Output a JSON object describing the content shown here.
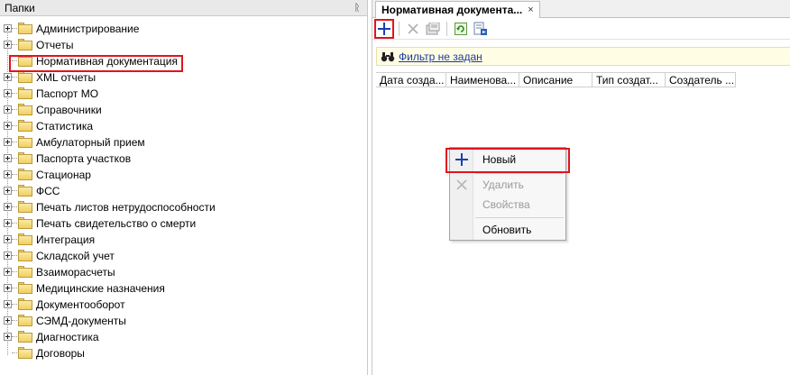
{
  "left_panel": {
    "title": "Папки",
    "pin_glyph": "ᚱ",
    "folders": [
      {
        "label": "Администрирование",
        "expandable": true
      },
      {
        "label": "Отчеты",
        "expandable": true
      },
      {
        "label": "Нормативная документация",
        "expandable": false,
        "selected": true
      },
      {
        "label": "XML отчеты",
        "expandable": true
      },
      {
        "label": "Паспорт МО",
        "expandable": true
      },
      {
        "label": "Справочники",
        "expandable": true
      },
      {
        "label": "Статистика",
        "expandable": true
      },
      {
        "label": "Амбулаторный прием",
        "expandable": true
      },
      {
        "label": "Паспорта участков",
        "expandable": true
      },
      {
        "label": "Стационар",
        "expandable": true
      },
      {
        "label": "ФСС",
        "expandable": true
      },
      {
        "label": "Печать листов нетрудоспособности",
        "expandable": true
      },
      {
        "label": "Печать свидетельство о смерти",
        "expandable": true
      },
      {
        "label": "Интеграция",
        "expandable": true
      },
      {
        "label": "Складской учет",
        "expandable": true
      },
      {
        "label": "Взаиморасчеты",
        "expandable": true
      },
      {
        "label": "Медицинские назначения",
        "expandable": true
      },
      {
        "label": "Документооборот",
        "expandable": true
      },
      {
        "label": "СЭМД-документы",
        "expandable": true
      },
      {
        "label": "Диагностика",
        "expandable": true
      },
      {
        "label": "Договоры",
        "expandable": false
      }
    ]
  },
  "right_panel": {
    "tab": {
      "label": "Нормативная документа...",
      "close_glyph": "×"
    },
    "toolbar": {
      "buttons": [
        {
          "name": "add-button",
          "icon": "plus-icon",
          "enabled": true
        },
        {
          "name": "delete-button",
          "icon": "x-icon",
          "enabled": false
        },
        {
          "name": "properties-button",
          "icon": "properties-icon",
          "enabled": false
        },
        {
          "name": "refresh-button",
          "icon": "refresh-icon",
          "enabled": true
        },
        {
          "name": "export-button",
          "icon": "export-icon",
          "enabled": true
        }
      ]
    },
    "filter": {
      "label": "Фильтр не задан"
    },
    "columns": [
      {
        "label": "Дата созда..."
      },
      {
        "label": "Наименова..."
      },
      {
        "label": "Описание"
      },
      {
        "label": "Тип создат..."
      },
      {
        "label": "Создатель ..."
      }
    ]
  },
  "context_menu": {
    "items": [
      {
        "label": "Новый",
        "icon": "plus-icon",
        "enabled": true
      },
      {
        "label": "Удалить",
        "icon": "x-icon",
        "enabled": false
      },
      {
        "label": "Свойства",
        "icon": "",
        "enabled": false
      },
      {
        "label": "Обновить",
        "icon": "",
        "enabled": true
      }
    ]
  },
  "colors": {
    "highlight": "#e0141e",
    "plus_blue": "#1b3fb0",
    "filter_bg": "#fffde4",
    "folder_yellow": "#f2cf5f"
  }
}
